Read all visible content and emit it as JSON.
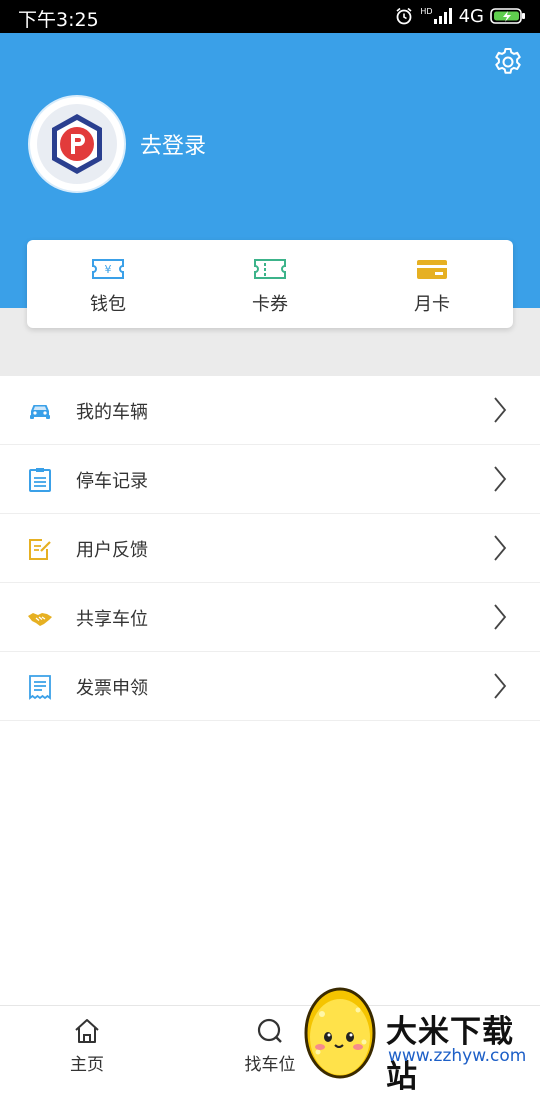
{
  "status_bar": {
    "time": "下午3:25",
    "network": "4G",
    "hd": "HD"
  },
  "header": {
    "login_text": "去登录"
  },
  "wallet": {
    "items": [
      {
        "label": "钱包",
        "icon": "wallet-icon",
        "color": "#3aa0e8"
      },
      {
        "label": "卡券",
        "icon": "ticket-icon",
        "color": "#3cb38a"
      },
      {
        "label": "月卡",
        "icon": "card-icon",
        "color": "#e6b022"
      }
    ]
  },
  "menu": {
    "items": [
      {
        "label": "我的车辆",
        "icon": "car-icon"
      },
      {
        "label": "停车记录",
        "icon": "clipboard-icon"
      },
      {
        "label": "用户反馈",
        "icon": "edit-note-icon"
      },
      {
        "label": "共享车位",
        "icon": "handshake-icon"
      },
      {
        "label": "发票申领",
        "icon": "receipt-icon"
      }
    ]
  },
  "tabbar": {
    "items": [
      {
        "label": "主页",
        "icon": "home-icon"
      },
      {
        "label": "找车位",
        "icon": "search-icon"
      }
    ]
  },
  "watermark": {
    "title": "大米下载站",
    "url": "www.zzhyw.com"
  },
  "colors": {
    "header_blue": "#3aa0e8",
    "gray_band": "#ebebeb"
  }
}
